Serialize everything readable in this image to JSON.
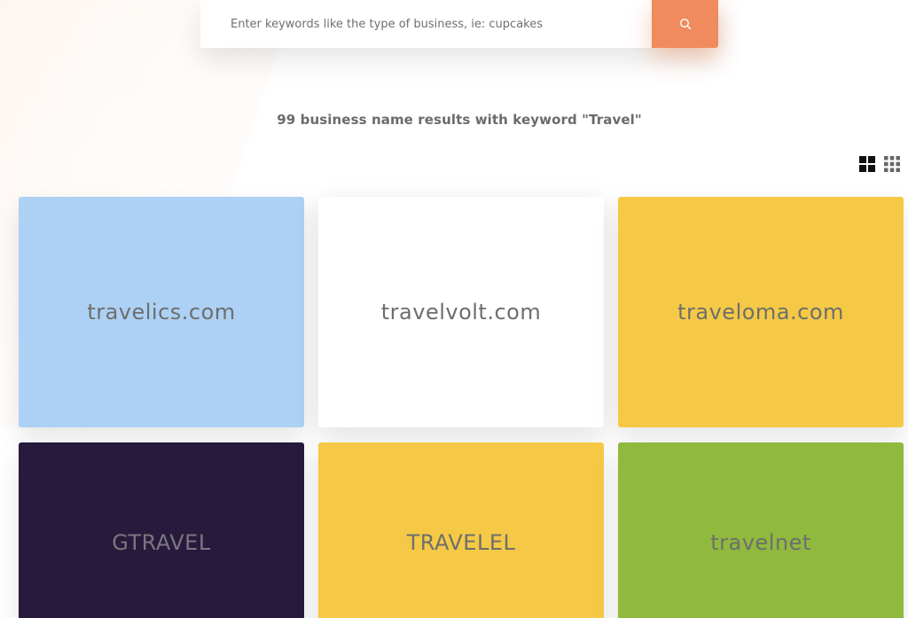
{
  "search": {
    "placeholder": "Enter keywords like the type of business, ie: cupcakes",
    "value": "",
    "button_icon": "search-icon"
  },
  "results": {
    "heading": "99 business name results with keyword \"Travel\""
  },
  "view_toggle": {
    "large_grid_icon": "large-grid-icon",
    "small_grid_icon": "small-grid-icon",
    "active": "large"
  },
  "cards": [
    {
      "name": "travelics.com",
      "bg": "#acd1f4"
    },
    {
      "name": "travelvolt.com",
      "bg": "#ffffff"
    },
    {
      "name": "traveloma.com",
      "bg": "#f5c945"
    },
    {
      "name": "GTRAVEL",
      "bg": "#271a3c"
    },
    {
      "name": "TRAVELEL",
      "bg": "#f5c945"
    },
    {
      "name": "travelnet",
      "bg": "#8fba3d"
    }
  ],
  "colors": {
    "accent": "#ef8b5c",
    "heading_text": "#6b6b6b",
    "card_text": "#6e6e6e"
  }
}
